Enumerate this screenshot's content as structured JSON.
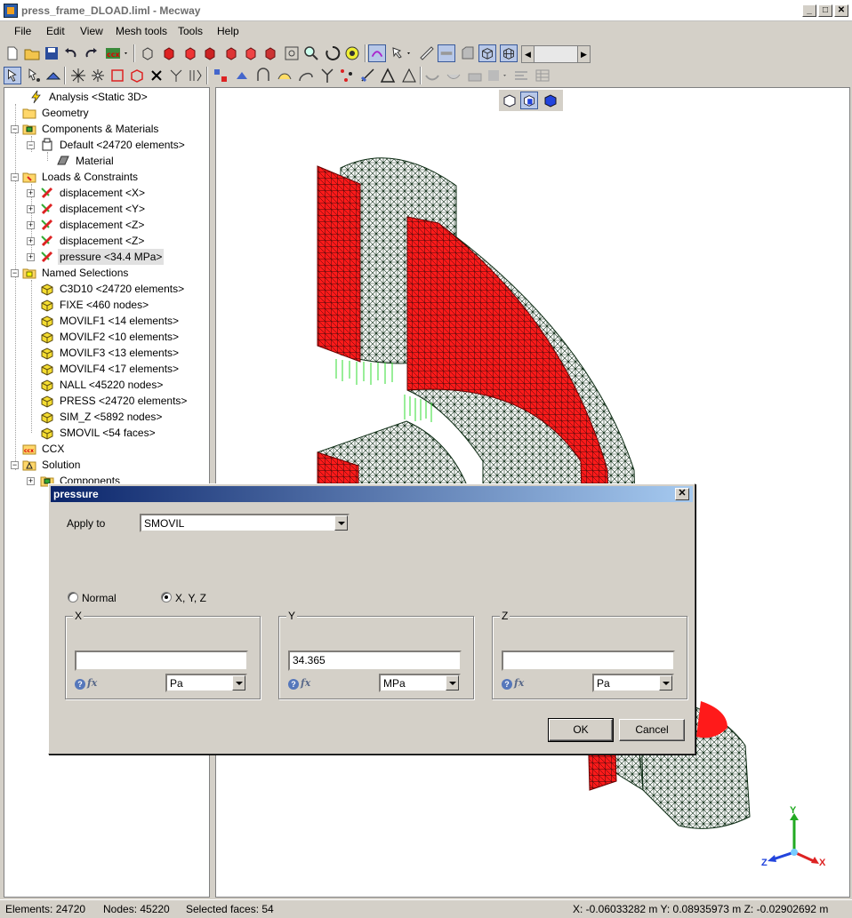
{
  "window": {
    "title": "press_frame_DLOAD.liml - Mecway",
    "controls": [
      "minimize",
      "maximize",
      "close"
    ]
  },
  "menu": [
    "File",
    "Edit",
    "View",
    "Mesh tools",
    "Tools",
    "Help"
  ],
  "tree": {
    "items": [
      {
        "label": "Analysis <Static 3D>",
        "icon": "lightning-icon"
      },
      {
        "label": "Geometry",
        "icon": "folder-icon"
      },
      {
        "label": "Components & Materials",
        "icon": "components-icon"
      },
      {
        "label": "Default <24720 elements>",
        "icon": "component-icon"
      },
      {
        "label": "Material",
        "icon": "material-icon"
      },
      {
        "label": "Loads & Constraints",
        "icon": "loads-folder-icon"
      },
      {
        "label": "displacement <X>",
        "icon": "displacement-icon"
      },
      {
        "label": "displacement <Y>",
        "icon": "displacement-icon"
      },
      {
        "label": "displacement <Z>",
        "icon": "displacement-icon"
      },
      {
        "label": "displacement <Z>",
        "icon": "displacement-icon"
      },
      {
        "label": "pressure <34.4 MPa>",
        "icon": "pressure-icon"
      },
      {
        "label": "Named Selections",
        "icon": "selections-folder-icon"
      },
      {
        "label": "C3D10 <24720 elements>",
        "icon": "selection-icon"
      },
      {
        "label": "FIXE <460 nodes>",
        "icon": "selection-icon"
      },
      {
        "label": "MOVILF1 <14 elements>",
        "icon": "selection-icon"
      },
      {
        "label": "MOVILF2 <10 elements>",
        "icon": "selection-icon"
      },
      {
        "label": "MOVILF3 <13 elements>",
        "icon": "selection-icon"
      },
      {
        "label": "MOVILF4 <17 elements>",
        "icon": "selection-icon"
      },
      {
        "label": "NALL <45220 nodes>",
        "icon": "selection-icon"
      },
      {
        "label": "PRESS <24720 elements>",
        "icon": "selection-icon"
      },
      {
        "label": "SIM_Z <5892 nodes>",
        "icon": "selection-icon"
      },
      {
        "label": "SMOVIL <54 faces>",
        "icon": "selection-icon"
      },
      {
        "label": "CCX",
        "icon": "ccx-icon"
      },
      {
        "label": "Solution",
        "icon": "solution-icon"
      },
      {
        "label": "Components",
        "icon": "components-icon"
      }
    ]
  },
  "dialog": {
    "title": "pressure",
    "apply_to_label": "Apply to",
    "apply_to_value": "SMOVIL",
    "radio_normal": "Normal",
    "radio_xyz": "X, Y, Z",
    "selected_mode": "X, Y, Z",
    "groups": [
      {
        "caption": "X",
        "value": "",
        "unit": "Pa"
      },
      {
        "caption": "Y",
        "value": "34.365",
        "unit": "MPa"
      },
      {
        "caption": "Z",
        "value": "",
        "unit": "Pa"
      }
    ],
    "fx_label": "fx",
    "ok_label": "OK",
    "cancel_label": "Cancel"
  },
  "status": {
    "elements": "Elements: 24720",
    "nodes": "Nodes: 45220",
    "selected": "Selected faces: 54",
    "coords": "X: -0.06033282 m Y: 0.08935973 m Z: -0.02902692 m"
  },
  "triad": {
    "x": "X",
    "y": "Y",
    "z": "Z"
  },
  "colors": {
    "selected_face": "#ff1a1a",
    "mesh": "#0b2a12",
    "constraint": "#33dd33",
    "axis_x": "#dd2222",
    "axis_y": "#22aa22",
    "axis_z": "#2244dd"
  }
}
